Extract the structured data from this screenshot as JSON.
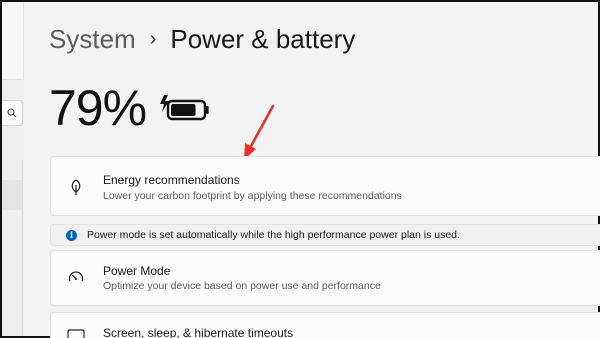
{
  "breadcrumb": {
    "parent": "System",
    "separator": "›",
    "current": "Power & battery"
  },
  "battery": {
    "percent_text": "79%",
    "level": 0.79,
    "icon": "battery-charging-icon"
  },
  "cards": [
    {
      "icon": "leaf-icon",
      "title": "Energy recommendations",
      "subtitle": "Lower your carbon footprint by applying these recommendations"
    },
    {
      "icon": "gauge-icon",
      "title": "Power Mode",
      "subtitle": "Optimize your device based on power use and performance"
    },
    {
      "icon": "screen-sleep-icon",
      "title": "Screen, sleep, & hibernate timeouts",
      "subtitle": ""
    }
  ],
  "info_banner": {
    "icon": "info-icon",
    "glyph": "i",
    "text": "Power mode is set automatically while the high performance power plan is used."
  },
  "sidebar": {
    "search_icon": "search-icon"
  },
  "colors": {
    "background": "#f3f3f3",
    "card": "#fbfbfb",
    "accent": "#0067c0",
    "annotation_arrow": "#e8322b"
  }
}
